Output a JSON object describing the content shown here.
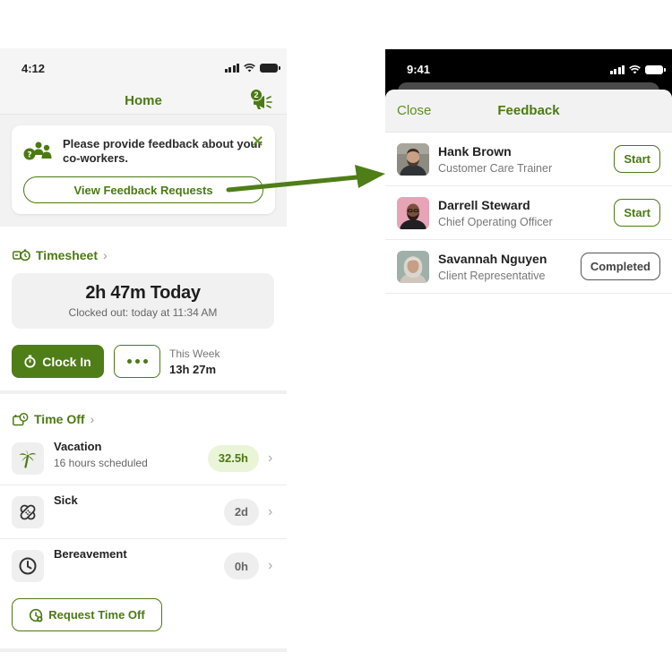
{
  "left": {
    "status": {
      "time": "4:12"
    },
    "nav": {
      "title": "Home",
      "badge_count": "2"
    },
    "feedback_card": {
      "message": "Please provide feedback about your co-workers.",
      "button_label": "View Feedback Requests",
      "close_symbol": "✕"
    },
    "timesheet": {
      "heading": "Timesheet",
      "today": "2h 47m Today",
      "clocked_out": "Clocked out: today at 11:34 AM",
      "clock_in_label": "Clock In",
      "this_week_label": "This Week",
      "this_week_value": "13h 27m"
    },
    "time_off": {
      "heading": "Time Off",
      "items": [
        {
          "name": "Vacation",
          "sub": "16 hours scheduled",
          "value": "32.5h",
          "icon": "palm-tree-icon"
        },
        {
          "name": "Sick",
          "sub": "",
          "value": "2d",
          "icon": "bandage-icon"
        },
        {
          "name": "Bereavement",
          "sub": "",
          "value": "0h",
          "icon": "clock-icon"
        }
      ],
      "request_label": "Request Time Off"
    }
  },
  "right": {
    "status": {
      "time": "9:41"
    },
    "nav": {
      "close_label": "Close",
      "title": "Feedback"
    },
    "people": [
      {
        "name": "Hank Brown",
        "role": "Customer Care Trainer",
        "action": "Start"
      },
      {
        "name": "Darrell Steward",
        "role": "Chief Operating Officer",
        "action": "Start"
      },
      {
        "name": "Savannah Nguyen",
        "role": "Client Representative",
        "action": "Completed"
      }
    ]
  },
  "colors": {
    "accent": "#4b7a13",
    "accent_light": "#eaf5d8",
    "pill_gray": "#eeeeee"
  }
}
